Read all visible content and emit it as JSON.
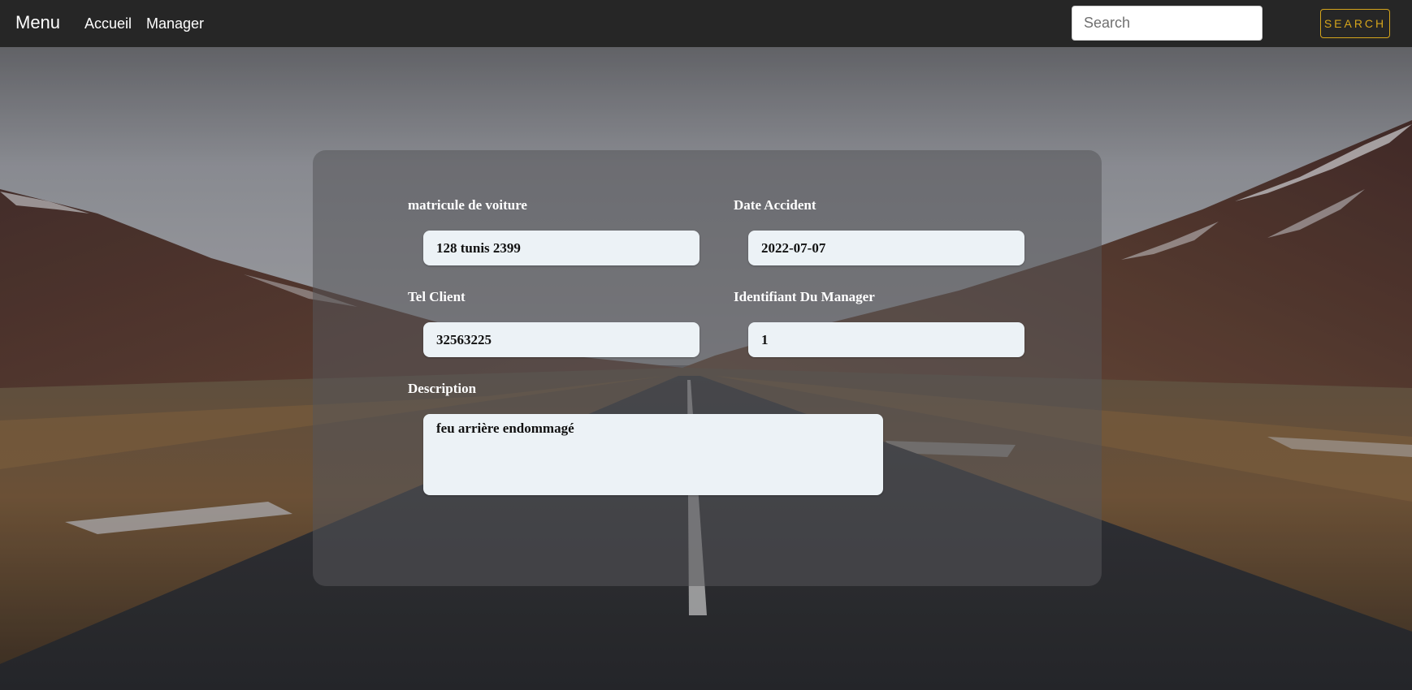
{
  "navbar": {
    "brand": "Menu",
    "links": [
      {
        "label": "Accueil"
      },
      {
        "label": "Manager"
      }
    ],
    "search": {
      "placeholder": "Search",
      "value": "",
      "button_label": "SEARCH"
    }
  },
  "form": {
    "fields": {
      "matricule": {
        "label": "matricule de voiture",
        "value": "128 tunis 2399"
      },
      "date_accident": {
        "label": "Date Accident",
        "value": "2022-07-07"
      },
      "tel_client": {
        "label": "Tel Client",
        "value": "32563225"
      },
      "id_manager": {
        "label": "Identifiant Du Manager",
        "value": "1"
      },
      "description": {
        "label": "Description",
        "value": "feu arrière endommagé"
      }
    }
  },
  "colors": {
    "navbar_bg": "#262626",
    "search_button_accent": "#d4a41c",
    "input_bg": "#ecf2f6"
  },
  "background": {
    "icon": "road-landscape-photo"
  }
}
